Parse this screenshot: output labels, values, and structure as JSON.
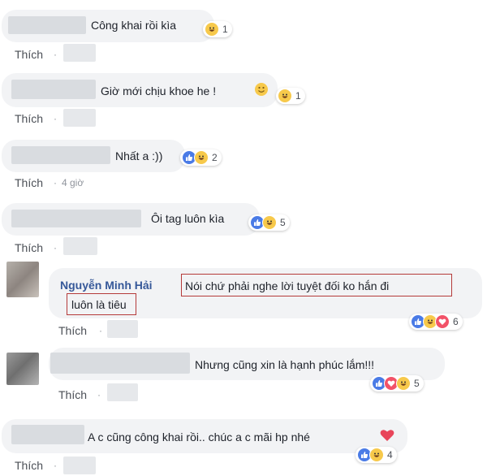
{
  "comments": [
    {
      "text": "Công khai rồi kìa",
      "like_label": "Thích",
      "separator": "·",
      "reaction_count": "1"
    },
    {
      "text": "Giờ mới chịu khoe he !",
      "like_label": "Thích",
      "separator": "·",
      "reaction_count": "1"
    },
    {
      "text": "Nhất a :))",
      "like_label": "Thích",
      "separator": "·",
      "time": "4 giờ",
      "reaction_count": "2"
    },
    {
      "text": "Ôi tag luôn kìa",
      "like_label": "Thích",
      "separator": "·",
      "reaction_count": "5"
    },
    {
      "author": "Nguyễn Minh Hải",
      "text_line1": "Nói chứ phải nghe lời tuyệt đối ko hắn đi",
      "text_line2": "luôn là tiêu",
      "like_label": "Thích",
      "separator": "·",
      "reaction_count": "6"
    },
    {
      "text": "Nhưng cũng xin là hạnh phúc lắm!!!",
      "like_label": "Thích",
      "separator": "·",
      "reaction_count": "5"
    },
    {
      "text": "A c cũng công khai rồi.. chúc a c mãi hp nhé",
      "like_label": "Thích",
      "separator": "·",
      "reaction_count": "4"
    }
  ],
  "icons": {
    "like": "like-reaction-icon",
    "haha": "haha-reaction-icon",
    "love": "love-reaction-icon",
    "smile": "smile-emoji-icon",
    "heart": "heart-emoji-icon"
  },
  "colors": {
    "bubble": "#f2f3f5",
    "author": "#365899",
    "text": "#1d2129",
    "meta": "#90949c",
    "highlight_box": "#b53a3a",
    "like_blue": "#4a7be6",
    "haha_yellow": "#f7c94b",
    "love_red": "#f25268"
  }
}
